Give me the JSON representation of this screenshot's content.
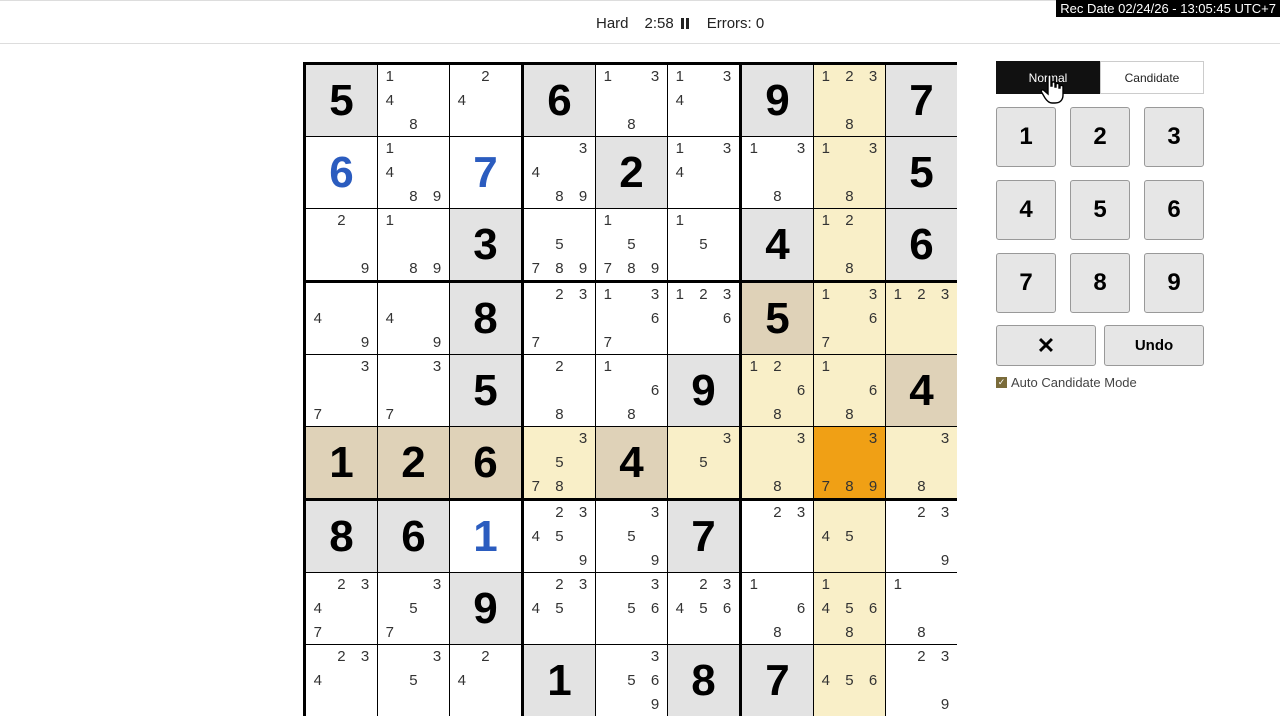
{
  "status": {
    "difficulty": "Hard",
    "timer": "2:58",
    "errors": "Errors: 0"
  },
  "rec_date": "Rec Date  02/24/26 - 13:05:45  UTC+7",
  "controls": {
    "mode_normal": "Normal",
    "mode_candidate": "Candidate",
    "numbers": [
      "1",
      "2",
      "3",
      "4",
      "5",
      "6",
      "7",
      "8",
      "9"
    ],
    "erase_symbol": "✕",
    "undo": "Undo",
    "auto_candidate": "Auto Candidate Mode",
    "auto_candidate_checked": true
  },
  "colors": {
    "given_bg": "#e3e3e3",
    "highlight": "#f9efc8",
    "highlight_dark": "#dfd2b8",
    "selected": "#f0a015",
    "user_digit": "#2b5cbf"
  },
  "grid": [
    [
      {
        "v": "5",
        "t": "given"
      },
      {
        "c": [
          1,
          4,
          8
        ]
      },
      {
        "c": [
          2,
          4
        ]
      },
      {
        "v": "6",
        "t": "given"
      },
      {
        "c": [
          1,
          3,
          8
        ]
      },
      {
        "c": [
          1,
          3,
          4
        ]
      },
      {
        "v": "9",
        "t": "given"
      },
      {
        "c": [
          1,
          2,
          3,
          8
        ],
        "h": "hl"
      },
      {
        "v": "7",
        "t": "given"
      }
    ],
    [
      {
        "v": "6",
        "t": "user"
      },
      {
        "c": [
          1,
          4,
          8,
          9
        ]
      },
      {
        "v": "7",
        "t": "user"
      },
      {
        "c": [
          3,
          4,
          8,
          9
        ]
      },
      {
        "v": "2",
        "t": "given"
      },
      {
        "c": [
          1,
          3,
          4
        ]
      },
      {
        "c": [
          1,
          3,
          8
        ]
      },
      {
        "c": [
          1,
          3,
          8
        ],
        "h": "hl"
      },
      {
        "v": "5",
        "t": "given"
      }
    ],
    [
      {
        "c": [
          2,
          9
        ]
      },
      {
        "c": [
          1,
          8,
          9
        ]
      },
      {
        "v": "3",
        "t": "given"
      },
      {
        "c": [
          5,
          7,
          8,
          9
        ]
      },
      {
        "c": [
          1,
          5,
          7,
          8,
          9
        ]
      },
      {
        "c": [
          1,
          5
        ]
      },
      {
        "v": "4",
        "t": "given"
      },
      {
        "c": [
          1,
          2,
          8
        ],
        "h": "hl"
      },
      {
        "v": "6",
        "t": "given"
      }
    ],
    [
      {
        "c": [
          4,
          9
        ]
      },
      {
        "c": [
          4,
          9
        ]
      },
      {
        "v": "8",
        "t": "given"
      },
      {
        "c": [
          2,
          3,
          7
        ]
      },
      {
        "c": [
          1,
          3,
          6,
          7
        ]
      },
      {
        "c": [
          1,
          2,
          3,
          6
        ]
      },
      {
        "v": "5",
        "t": "given",
        "h": "hl2"
      },
      {
        "c": [
          1,
          3,
          6,
          7
        ],
        "h": "hl"
      },
      {
        "c": [
          1,
          2,
          3
        ],
        "h": "hl"
      }
    ],
    [
      {
        "c": [
          3,
          7
        ]
      },
      {
        "c": [
          3,
          7
        ]
      },
      {
        "v": "5",
        "t": "given"
      },
      {
        "c": [
          2,
          8
        ]
      },
      {
        "c": [
          1,
          6,
          8
        ]
      },
      {
        "v": "9",
        "t": "given"
      },
      {
        "c": [
          1,
          2,
          6,
          8
        ],
        "h": "hl"
      },
      {
        "c": [
          1,
          6,
          8
        ],
        "h": "hl"
      },
      {
        "v": "4",
        "t": "given",
        "h": "hl2"
      }
    ],
    [
      {
        "v": "1",
        "t": "given",
        "h": "hl2"
      },
      {
        "v": "2",
        "t": "given",
        "h": "hl2"
      },
      {
        "v": "6",
        "t": "given",
        "h": "hl2"
      },
      {
        "c": [
          3,
          5,
          7,
          8
        ],
        "h": "hl"
      },
      {
        "v": "4",
        "t": "given",
        "h": "hl2"
      },
      {
        "c": [
          3,
          5
        ],
        "h": "hl"
      },
      {
        "c": [
          3,
          8
        ],
        "h": "hl"
      },
      {
        "c": [
          3,
          7,
          8,
          9
        ],
        "h": "sel"
      },
      {
        "c": [
          3,
          8
        ],
        "h": "hl"
      }
    ],
    [
      {
        "v": "8",
        "t": "given"
      },
      {
        "v": "6",
        "t": "given"
      },
      {
        "v": "1",
        "t": "user"
      },
      {
        "c": [
          2,
          3,
          4,
          5,
          9
        ]
      },
      {
        "c": [
          3,
          5,
          9
        ]
      },
      {
        "v": "7",
        "t": "given"
      },
      {
        "c": [
          2,
          3
        ]
      },
      {
        "c": [
          4,
          5
        ],
        "h": "hl"
      },
      {
        "c": [
          2,
          3,
          9
        ]
      }
    ],
    [
      {
        "c": [
          2,
          3,
          4,
          7
        ]
      },
      {
        "c": [
          3,
          5,
          7
        ]
      },
      {
        "v": "9",
        "t": "given"
      },
      {
        "c": [
          2,
          3,
          4,
          5
        ]
      },
      {
        "c": [
          3,
          5,
          6
        ]
      },
      {
        "c": [
          2,
          3,
          4,
          5,
          6
        ]
      },
      {
        "c": [
          1,
          6,
          8
        ]
      },
      {
        "c": [
          1,
          4,
          5,
          6,
          8
        ],
        "h": "hl"
      },
      {
        "c": [
          1,
          8
        ]
      }
    ],
    [
      {
        "c": [
          2,
          3,
          4
        ]
      },
      {
        "c": [
          3,
          5
        ]
      },
      {
        "c": [
          2,
          4
        ]
      },
      {
        "v": "1",
        "t": "given"
      },
      {
        "c": [
          3,
          5,
          6,
          9
        ]
      },
      {
        "v": "8",
        "t": "given"
      },
      {
        "v": "7",
        "t": "given"
      },
      {
        "c": [
          4,
          5,
          6
        ],
        "h": "hl"
      },
      {
        "c": [
          2,
          3,
          9
        ]
      }
    ]
  ]
}
